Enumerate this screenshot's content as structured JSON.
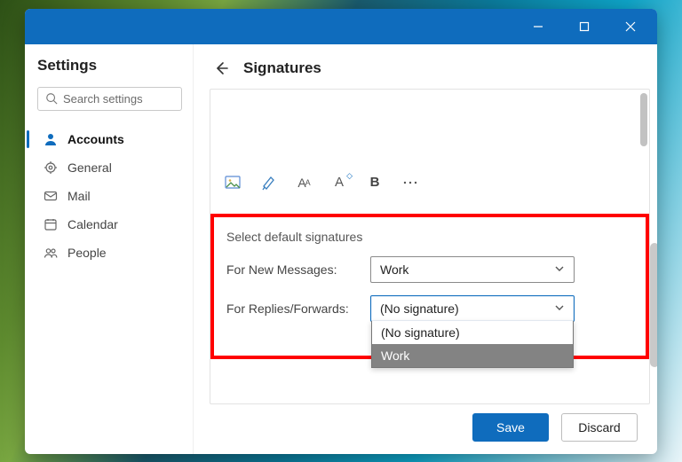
{
  "window_controls": {
    "minimize": "minimize",
    "maximize": "maximize",
    "close": "close"
  },
  "sidebar": {
    "title": "Settings",
    "search_placeholder": "Search settings",
    "items": [
      {
        "icon": "person-icon",
        "label": "Accounts",
        "active": true
      },
      {
        "icon": "gear-icon",
        "label": "General",
        "active": false
      },
      {
        "icon": "mail-icon",
        "label": "Mail",
        "active": false
      },
      {
        "icon": "calendar-icon",
        "label": "Calendar",
        "active": false
      },
      {
        "icon": "people-icon",
        "label": "People",
        "active": false
      }
    ]
  },
  "page": {
    "title": "Signatures",
    "toolbar": {
      "insert_image": "Insert image",
      "format_painter": "Format painter",
      "font_size": "Font size",
      "font_color": "Font color",
      "bold": "B",
      "more": "More"
    },
    "section_title": "Select default signatures",
    "new_messages": {
      "label": "For New Messages:",
      "value": "Work"
    },
    "replies_forwards": {
      "label": "For Replies/Forwards:",
      "value": "(No signature)",
      "options": [
        "(No signature)",
        "Work"
      ],
      "open": true,
      "highlighted_index": 1
    }
  },
  "footer": {
    "save": "Save",
    "discard": "Discard"
  },
  "colors": {
    "accent": "#0f6cbd",
    "highlight_border": "#ff0000"
  }
}
